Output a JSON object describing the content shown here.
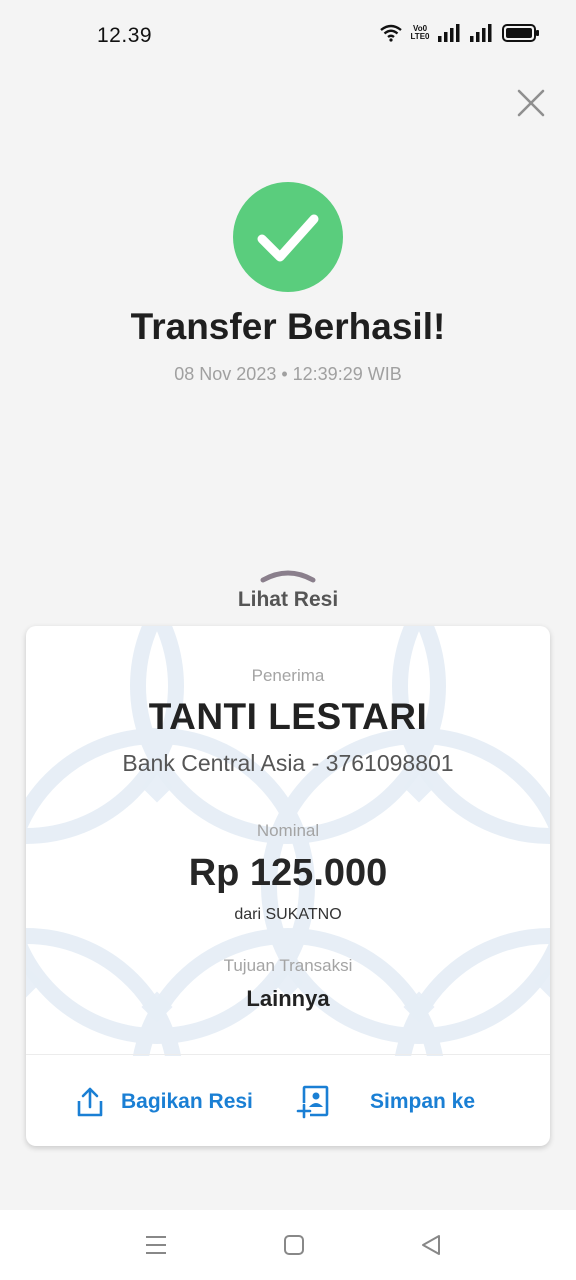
{
  "status_bar": {
    "time": "12.39",
    "volte_line1": "Vo0",
    "volte_line2": "LTE0"
  },
  "header": {
    "close_icon": "close-icon",
    "success_icon": "checkmark-icon",
    "title": "Transfer Berhasil!",
    "timestamp": "08 Nov 2023 • 12:39:29 WIB",
    "success_color": "#5acd7d"
  },
  "receipt_toggle": {
    "label": "Lihat Resi",
    "icon": "chevron-up-icon"
  },
  "receipt": {
    "recipient_label": "Penerima",
    "recipient_name": "TANTI LESTARI",
    "bank_info": "Bank Central Asia - 3761098801",
    "amount_label": "Nominal",
    "amount": "Rp 125.000",
    "sender": "dari SUKATNO",
    "purpose_label": "Tujuan Transaksi",
    "purpose": "Lainnya"
  },
  "actions": {
    "share_label": "Bagikan Resi",
    "share_icon": "share-icon",
    "save_label": "Simpan ke",
    "save_icon": "contact-add-icon",
    "accent_color": "#1a7fd4"
  },
  "nav": {
    "menu_icon": "menu-icon",
    "home_icon": "home-square-icon",
    "back_icon": "back-triangle-icon"
  }
}
